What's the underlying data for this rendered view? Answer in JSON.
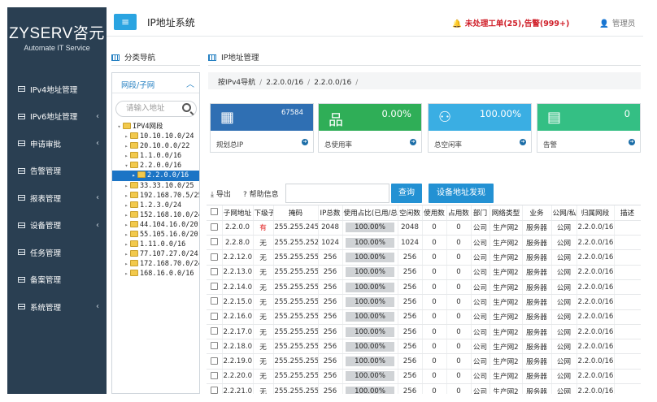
{
  "sidebar": {
    "brand": "ZYSERV咨元",
    "tagline": "Automate IT Service",
    "items": [
      {
        "label": "IPv4地址管理",
        "caret": ""
      },
      {
        "label": "IPv6地址管理",
        "caret": "‹"
      },
      {
        "label": "申请审批",
        "caret": "‹"
      },
      {
        "label": "告警管理",
        "caret": ""
      },
      {
        "label": "报表管理",
        "caret": "‹"
      },
      {
        "label": "设备管理",
        "caret": "‹"
      },
      {
        "label": "任务管理",
        "caret": ""
      },
      {
        "label": "备案管理",
        "caret": ""
      },
      {
        "label": "系统管理",
        "caret": "‹"
      }
    ]
  },
  "header": {
    "menu_glyph": "≡",
    "title": "IP地址系统",
    "alert": "未处理工单(25),告警(999+)",
    "user": "管理员"
  },
  "left_panel": {
    "title": "分类导航",
    "tab": "网段/子网",
    "search_placeholder": "请输入地址",
    "tree": [
      {
        "label": "IPV4网段",
        "arrow": "▾",
        "depth": 0,
        "selected": false
      },
      {
        "label": "10.10.10.0/24",
        "arrow": "▸",
        "depth": 1,
        "selected": false
      },
      {
        "label": "20.10.0.0/22",
        "arrow": "▸",
        "depth": 1,
        "selected": false
      },
      {
        "label": "1.1.0.0/16",
        "arrow": "▸",
        "depth": 1,
        "selected": false
      },
      {
        "label": "2.2.0.0/16",
        "arrow": "▾",
        "depth": 1,
        "selected": false
      },
      {
        "label": "2.2.0.0/16",
        "arrow": "▸",
        "depth": 2,
        "selected": true
      },
      {
        "label": "33.33.10.0/25",
        "arrow": "▸",
        "depth": 1,
        "selected": false
      },
      {
        "label": "192.168.70.5/25",
        "arrow": "▸",
        "depth": 1,
        "selected": false
      },
      {
        "label": "1.2.3.0/24",
        "arrow": "▸",
        "depth": 1,
        "selected": false
      },
      {
        "label": "152.168.10.0/24",
        "arrow": "▸",
        "depth": 1,
        "selected": false
      },
      {
        "label": "44.104.16.0/20",
        "arrow": "▸",
        "depth": 1,
        "selected": false
      },
      {
        "label": "55.105.16.0/20",
        "arrow": "▸",
        "depth": 1,
        "selected": false
      },
      {
        "label": "1.11.0.0/16",
        "arrow": "▸",
        "depth": 1,
        "selected": false
      },
      {
        "label": "77.107.27.0/24",
        "arrow": "▸",
        "depth": 1,
        "selected": false
      },
      {
        "label": "172.168.70.0/24",
        "arrow": "▸",
        "depth": 1,
        "selected": false
      },
      {
        "label": "168.16.0.0/16",
        "arrow": "▸",
        "depth": 1,
        "selected": false
      }
    ]
  },
  "main": {
    "title": "IP地址管理",
    "breadcrumb": [
      "按IPv4导航",
      "2.2.0.0/16",
      "2.2.0.0/16"
    ],
    "stats": [
      {
        "value": "67584",
        "label": "规划总IP",
        "color": "#2f6fb3",
        "icon": "▦",
        "small": true
      },
      {
        "value": "0.00%",
        "label": "总使用率",
        "color": "#2fae57",
        "icon": "品",
        "small": false
      },
      {
        "value": "100.00%",
        "label": "总空闲率",
        "color": "#3aaee3",
        "icon": "⚇",
        "small": false
      },
      {
        "value": "0",
        "label": "告警",
        "color": "#34bf84",
        "icon": "▤",
        "small": false
      }
    ],
    "toolbar": {
      "export": "导出",
      "help": "帮助信息",
      "query": "查询",
      "discover": "设备地址发现"
    },
    "table": {
      "headers": [
        "",
        "子网地址",
        "下级子网",
        "掩码",
        "IP总数",
        "使用占比(已用/总数)",
        "空闲数",
        "使用数",
        "占用数",
        "部门",
        "网络类型",
        "业务",
        "公网/私网",
        "归属网段",
        "描述"
      ],
      "rows": [
        [
          "2.2.0.0",
          "有",
          "255.255.245",
          "2048",
          "100.00%",
          "2048",
          "0",
          "0",
          "公司",
          "生产网2",
          "服务器",
          "公网",
          "2.2.0.0/16",
          ""
        ],
        [
          "2.2.8.0",
          "无",
          "255.255.252",
          "1024",
          "100.00%",
          "1024",
          "0",
          "0",
          "公司",
          "生产网2",
          "服务器",
          "公网",
          "2.2.0.0/16",
          ""
        ],
        [
          "2.2.12.0",
          "无",
          "255.255.255",
          "256",
          "100.00%",
          "256",
          "0",
          "0",
          "公司",
          "生产网2",
          "服务器",
          "公网",
          "2.2.0.0/16",
          ""
        ],
        [
          "2.2.13.0",
          "无",
          "255.255.255",
          "256",
          "100.00%",
          "256",
          "0",
          "0",
          "公司",
          "生产网2",
          "服务器",
          "公网",
          "2.2.0.0/16",
          ""
        ],
        [
          "2.2.14.0",
          "无",
          "255.255.255",
          "256",
          "100.00%",
          "256",
          "0",
          "0",
          "公司",
          "生产网2",
          "服务器",
          "公网",
          "2.2.0.0/16",
          ""
        ],
        [
          "2.2.15.0",
          "无",
          "255.255.255",
          "256",
          "100.00%",
          "256",
          "0",
          "0",
          "公司",
          "生产网2",
          "服务器",
          "公网",
          "2.2.0.0/16",
          ""
        ],
        [
          "2.2.16.0",
          "无",
          "255.255.255",
          "256",
          "100.00%",
          "256",
          "0",
          "0",
          "公司",
          "生产网2",
          "服务器",
          "公网",
          "2.2.0.0/16",
          ""
        ],
        [
          "2.2.17.0",
          "无",
          "255.255.255",
          "256",
          "100.00%",
          "256",
          "0",
          "0",
          "公司",
          "生产网2",
          "服务器",
          "公网",
          "2.2.0.0/16",
          ""
        ],
        [
          "2.2.18.0",
          "无",
          "255.255.255",
          "256",
          "100.00%",
          "256",
          "0",
          "0",
          "公司",
          "生产网2",
          "服务器",
          "公网",
          "2.2.0.0/16",
          ""
        ],
        [
          "2.2.19.0",
          "无",
          "255.255.255",
          "256",
          "100.00%",
          "256",
          "0",
          "0",
          "公司",
          "生产网2",
          "服务器",
          "公网",
          "2.2.0.0/16",
          ""
        ],
        [
          "2.2.20.0",
          "无",
          "255.255.255",
          "256",
          "100.00%",
          "256",
          "0",
          "0",
          "公司",
          "生产网2",
          "服务器",
          "公网",
          "2.2.0.0/16",
          ""
        ],
        [
          "2.2.21.0",
          "无",
          "255.255.255",
          "256",
          "100.00%",
          "256",
          "0",
          "0",
          "公司",
          "生产网2",
          "服务器",
          "公网",
          "2.2.0.0/16",
          ""
        ]
      ]
    }
  }
}
